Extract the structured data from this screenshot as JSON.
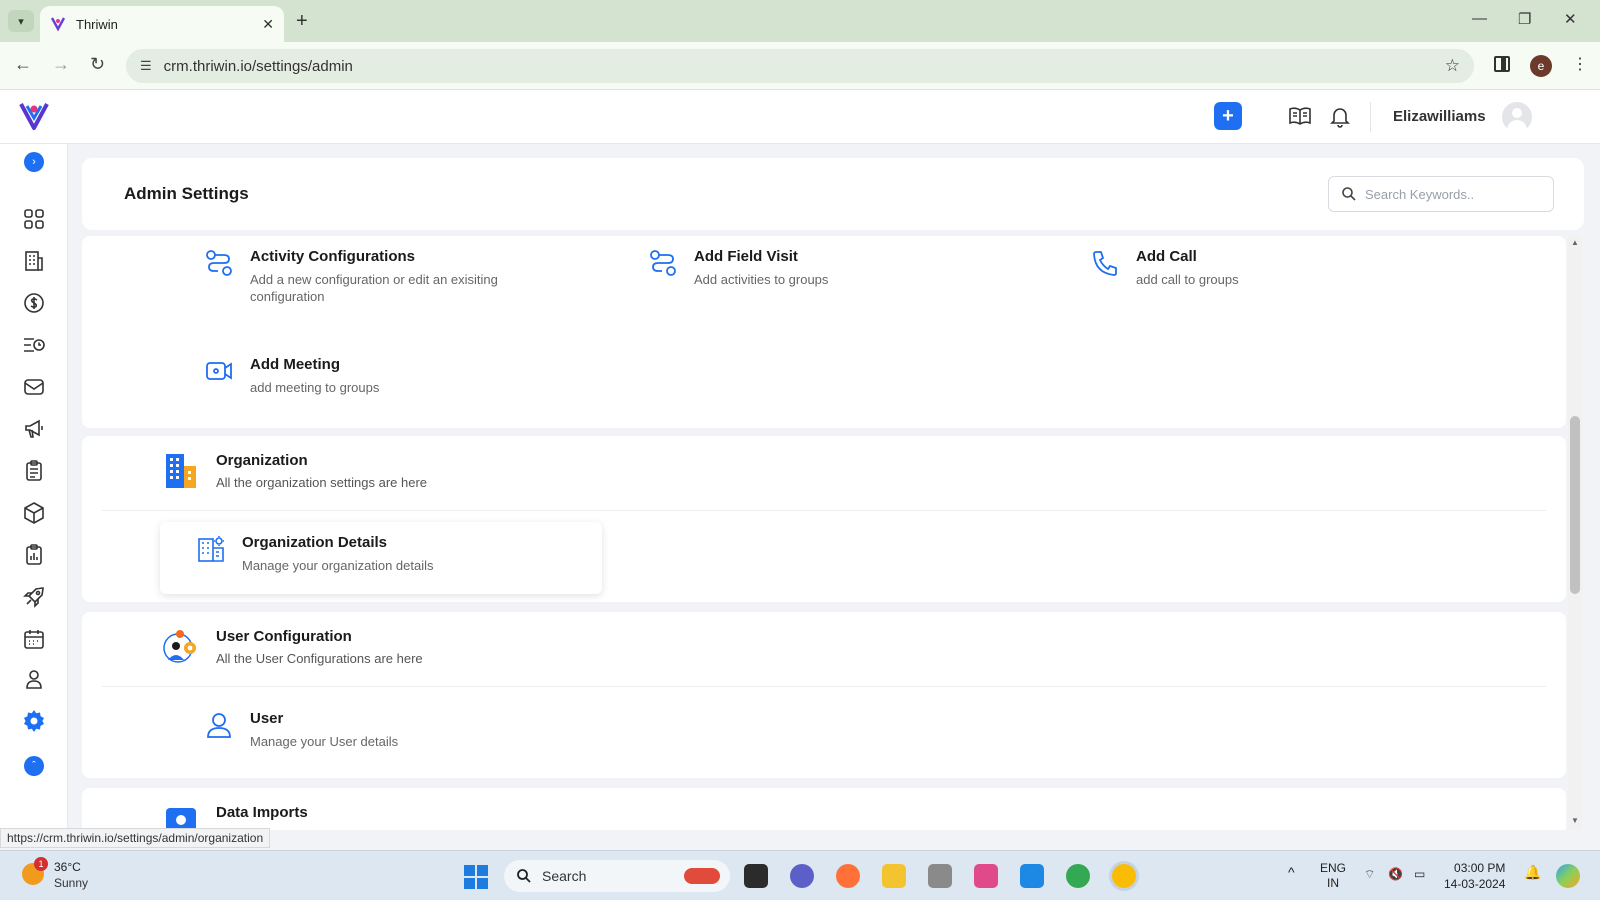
{
  "browser": {
    "tab_title": "Thriwin",
    "url": "crm.thriwin.io/settings/admin",
    "profile_initial": "e",
    "status_url": "https://crm.thriwin.io/settings/admin/organization"
  },
  "header": {
    "username": "Elizawilliams",
    "add_label": "+"
  },
  "page": {
    "title": "Admin Settings",
    "search_placeholder": "Search Keywords.."
  },
  "activities": [
    {
      "title": "Activity Configurations",
      "desc": "Add a new configuration or edit an exisiting configuration"
    },
    {
      "title": "Add Field Visit",
      "desc": "Add activities to groups"
    },
    {
      "title": "Add Call",
      "desc": "add call to groups"
    },
    {
      "title": "Add Meeting",
      "desc": "add meeting to groups"
    }
  ],
  "organization": {
    "title": "Organization",
    "desc": "All the organization settings are here",
    "items": [
      {
        "title": "Organization Details",
        "desc": "Manage your organization details"
      }
    ]
  },
  "user_config": {
    "title": "User Configuration",
    "desc": "All the User Configurations are here",
    "items": [
      {
        "title": "User",
        "desc": "Manage your User details"
      }
    ]
  },
  "data_imports": {
    "title": "Data Imports"
  },
  "taskbar": {
    "temp": "36°C",
    "condition": "Sunny",
    "weather_badge": "1",
    "search_label": "Search",
    "lang_line1": "ENG",
    "lang_line2": "IN",
    "time": "03:00 PM",
    "date": "14-03-2024"
  },
  "colors": {
    "accent": "#1e6ff1",
    "tabbar": "#d3e3d0",
    "taskbar": "#dce7f2"
  }
}
